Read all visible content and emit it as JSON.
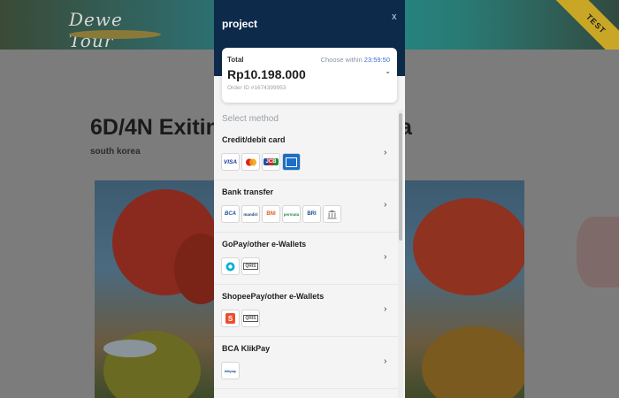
{
  "background": {
    "logo_text": "Dewe Tour",
    "ribbon": "TEST",
    "title": "6D/4N Exiting",
    "title_tail": "a",
    "subtitle": "south korea"
  },
  "modal": {
    "title": "project",
    "close": "x",
    "total": {
      "label": "Total",
      "choose_within": "Choose within",
      "timer": "23:59:50",
      "amount": "Rp10.198.000",
      "order_id": "Order ID #1674399953"
    },
    "select_method": "Select method",
    "methods": [
      {
        "label": "Credit/debit card",
        "logos": [
          "VISA",
          "mastercard",
          "JCB",
          "AMEX"
        ]
      },
      {
        "label": "Bank transfer",
        "logos": [
          "BCA",
          "mandiri",
          "BNI",
          "permata",
          "BRI",
          "bank"
        ]
      },
      {
        "label": "GoPay/other e-Wallets",
        "logos": [
          "gopay",
          "QRIS"
        ]
      },
      {
        "label": "ShopeePay/other e-Wallets",
        "logos": [
          "shopeepay",
          "QRIS"
        ]
      },
      {
        "label": "BCA KlikPay",
        "logos": [
          "klikpay"
        ]
      }
    ],
    "chevron": "›"
  },
  "colors": {
    "header_navy": "#0d2a4a",
    "timer_blue": "#3b6fd4",
    "ribbon_gold": "#c9a626"
  }
}
